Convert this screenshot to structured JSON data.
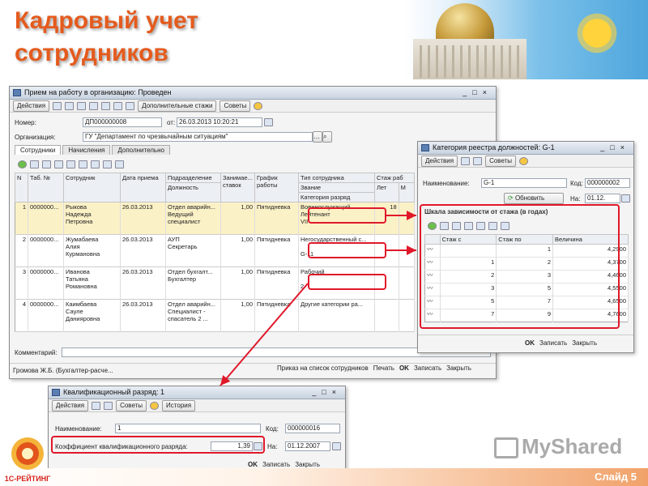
{
  "slide": {
    "title_line1": "Кадровый учет",
    "title_line2": "сотрудников",
    "slide_number": "Слайд 5",
    "logo_brand": "1С-РЕЙТИНГ",
    "watermark": "MyShared"
  },
  "main_window": {
    "title": "Прием на работу в организацию: Проведен",
    "toolbar": {
      "actions": "Действия",
      "extra": "Дополнительные стажи",
      "tips": "Советы"
    },
    "number_label": "Номер:",
    "number_value": "ДП000000008",
    "date_label": "от:",
    "date_value": "26.03.2013 10:20:21",
    "org_label": "Организация:",
    "org_value": "ГУ \"Департамент по чрезвычайным ситуациям\"",
    "tabs": [
      "Сотрудники",
      "Начисления",
      "Дополнительно"
    ],
    "columns": {
      "n": "N",
      "tab": "Таб. №",
      "employee": "Сотрудник",
      "hire_date": "Дата приема",
      "dept": "Подразделение",
      "position": "Должность",
      "rates1": "Занимае...",
      "rates2": "ставок",
      "schedule1": "График",
      "schedule2": "работы",
      "type": "Тип сотрудника",
      "rank": "Звание",
      "category": "Категория разряд",
      "seniority": "Стаж раб",
      "years": "Лет",
      "months": "М"
    },
    "rows": [
      {
        "n": "1",
        "tab": "0000000...",
        "name": [
          "Рыкова",
          "Надежда",
          "Петровна"
        ],
        "date": "26.03.2013",
        "dept": "Отдел аварийн...",
        "position": [
          "Ведущий",
          "специалист"
        ],
        "rate": "1,00",
        "schedule": "Пятидневка",
        "type": "Военнослужащий",
        "rank": "Лейтенант",
        "cat": "VII",
        "years": "18"
      },
      {
        "n": "2",
        "tab": "0000000...",
        "name": [
          "Жумабаева",
          "Алия",
          "Курмановна"
        ],
        "date": "26.03.2013",
        "dept": "АУП",
        "position": [
          "Секретарь"
        ],
        "rate": "1,00",
        "schedule": "Пятидневка",
        "type": "Негосударственный с...",
        "rank": "",
        "cat": "G-11",
        "years": ""
      },
      {
        "n": "3",
        "tab": "0000000...",
        "name": [
          "Иванова",
          "Татьяна",
          "Романовна"
        ],
        "date": "26.03.2013",
        "dept": "Отдел бухгалт...",
        "position": [
          "Бухгалтер"
        ],
        "rate": "1,00",
        "schedule": "Пятидневка",
        "type": "Рабочий",
        "rank": "",
        "cat": "2",
        "years": ""
      },
      {
        "n": "4",
        "tab": "0000000...",
        "name": [
          "Каимбаева",
          "Сауле",
          "Данияровна"
        ],
        "date": "26.03.2013",
        "dept": "Отдел аварийн...",
        "position": [
          "Специалист -",
          "спасатель 2 ..."
        ],
        "rate": "1,00",
        "schedule": "Пятидневка",
        "type": "Другие категории ра...",
        "rank": "",
        "cat": "",
        "years": ""
      }
    ],
    "comment_label": "Комментарий:",
    "status_user": "Громова Ж.Б. (Бухгалтер-расче...",
    "status_order": "Приказ на список сотрудников",
    "status_print": "Печать",
    "status_ok": "OK",
    "status_save": "Записать",
    "status_close": "Закрыть"
  },
  "category_window": {
    "title": "Категория реестра должностей: G-1",
    "toolbar": {
      "actions": "Действия",
      "tips": "Советы"
    },
    "name_label": "Наименование:",
    "name_value": "G-1",
    "code_label": "Код:",
    "code_value": "000000002",
    "refresh_label": "Обновить",
    "on_label": "На:",
    "on_value": "01.12.",
    "scale_title": "Шкала зависимости от стажа (в годах)",
    "columns": {
      "from": "Стаж с",
      "to": "Стаж по",
      "value": "Величина"
    },
    "rows": [
      {
        "from": "",
        "to": "1",
        "value": "4,2900"
      },
      {
        "from": "1",
        "to": "2",
        "value": "4,3700"
      },
      {
        "from": "2",
        "to": "3",
        "value": "4,4600"
      },
      {
        "from": "3",
        "to": "5",
        "value": "4,5500"
      },
      {
        "from": "5",
        "to": "7",
        "value": "4,6500"
      },
      {
        "from": "7",
        "to": "9",
        "value": "4,7600"
      }
    ],
    "ok": "OK",
    "save": "Записать",
    "close": "Закрыть"
  },
  "qual_window": {
    "title": "Квалификационный разряд: 1",
    "toolbar": {
      "actions": "Действия",
      "tips": "Советы",
      "history": "История"
    },
    "name_label": "Наименование:",
    "name_value": "1",
    "code_label": "Код:",
    "code_value": "000000016",
    "coef_label": "Коэффициент квалификационного разряда:",
    "coef_value": "1,39",
    "on_label": "На:",
    "on_value": "01.12.2007",
    "ok": "OK",
    "save": "Записать",
    "close": "Закрыть"
  },
  "colors": {
    "title": "#e45b1e",
    "highlight": "#e0182a",
    "selected_row": "#fbf1c7"
  }
}
